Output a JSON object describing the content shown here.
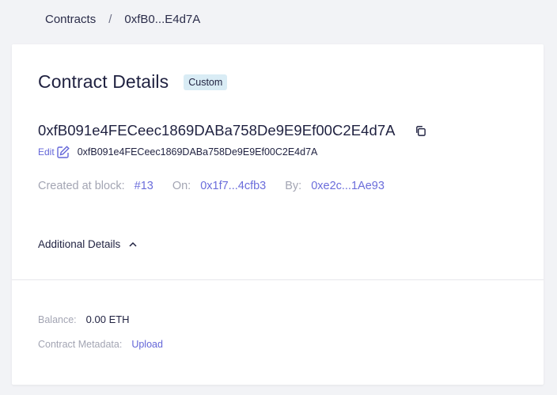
{
  "breadcrumb": {
    "root": "Contracts",
    "separator": "/",
    "current": "0xfB0...E4d7A"
  },
  "header": {
    "title": "Contract Details",
    "badge": "Custom"
  },
  "contract": {
    "address": "0xfB091e4FECeec1869DABa758De9E9Ef00C2E4d7A",
    "edit_label": "Edit",
    "alias": "0xfB091e4FECeec1869DABa758De9E9Ef00C2E4d7A"
  },
  "meta": {
    "created_label": "Created at block:",
    "block": "#13",
    "on_label": "On:",
    "tx_hash": "0x1f7...4cfb3",
    "by_label": "By:",
    "creator": "0xe2c...1Ae93"
  },
  "additional": {
    "label": "Additional Details"
  },
  "details": {
    "balance_label": "Balance:",
    "balance_value": "0.00 ETH",
    "metadata_label": "Contract Metadata:",
    "metadata_action": "Upload"
  },
  "icons": {
    "copy": "copy-icon",
    "edit": "edit-icon",
    "chevron": "chevron-up-icon"
  },
  "colors": {
    "accent": "#6466d8",
    "badge_bg": "#d9ecf5",
    "text": "#1f2140",
    "muted": "#a3a5b3",
    "background": "#f2f3f6"
  }
}
